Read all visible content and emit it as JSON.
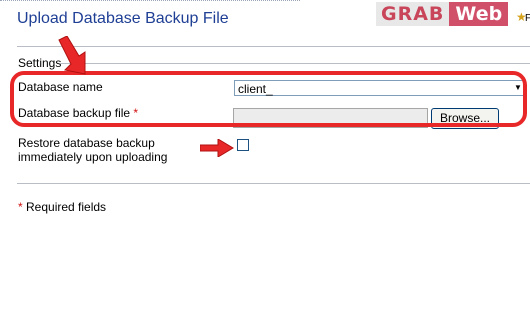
{
  "header": {
    "title": "Upload Database Backup File",
    "corner_letter": "F"
  },
  "watermark": {
    "part1": "GRAB",
    "part2": "Web"
  },
  "section": {
    "legend": "Settings"
  },
  "form": {
    "database_name_label": "Database name",
    "database_name_value": "client_",
    "backup_file_label": "Database backup file",
    "required_mark": "*",
    "browse_label": "Browse...",
    "restore_label_line1": "Restore database backup",
    "restore_label_line2": "immediately upon uploading"
  },
  "footer": {
    "required_mark": "*",
    "required_text": "Required fields"
  },
  "annotations": {
    "color": "#e82828"
  }
}
